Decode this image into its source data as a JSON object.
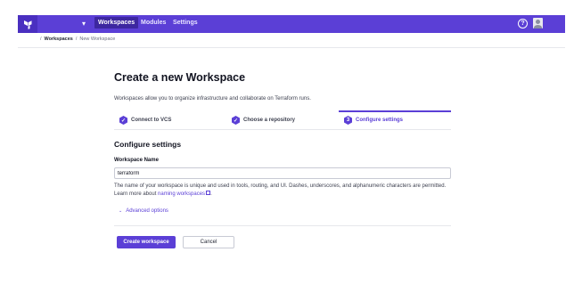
{
  "nav": {
    "logo_icon": "terraform-logo-icon",
    "items": [
      {
        "label": "Workspaces",
        "active": true
      },
      {
        "label": "Modules",
        "active": false
      },
      {
        "label": "Settings",
        "active": false
      }
    ],
    "help_symbol": "?"
  },
  "breadcrumb": {
    "separator": "/",
    "items": [
      "Workspaces",
      "New Workspace"
    ]
  },
  "main": {
    "title": "Create a new Workspace",
    "description": "Workspaces allow you to organize infrastructure and collaborate on Terraform runs.",
    "steps": [
      {
        "label": "Connect to VCS",
        "status": "done"
      },
      {
        "label": "Choose a repository",
        "status": "done"
      },
      {
        "number": "3",
        "label": "Configure settings",
        "status": "active"
      }
    ],
    "section_title": "Configure settings",
    "field": {
      "label": "Workspace Name",
      "value": "terraform"
    },
    "help": {
      "text": "The name of your workspace is unique and used in tools, routing, and UI. Dashes, underscores, and alphanumeric characters are permitted. Learn more about ",
      "link": "naming workspaces",
      "suffix": "."
    },
    "advanced_label": "Advanced options",
    "buttons": {
      "create": "Create workspace",
      "cancel": "Cancel"
    }
  },
  "colors": {
    "accent": "#5b3fd6",
    "nav_active": "#3d27a0"
  }
}
